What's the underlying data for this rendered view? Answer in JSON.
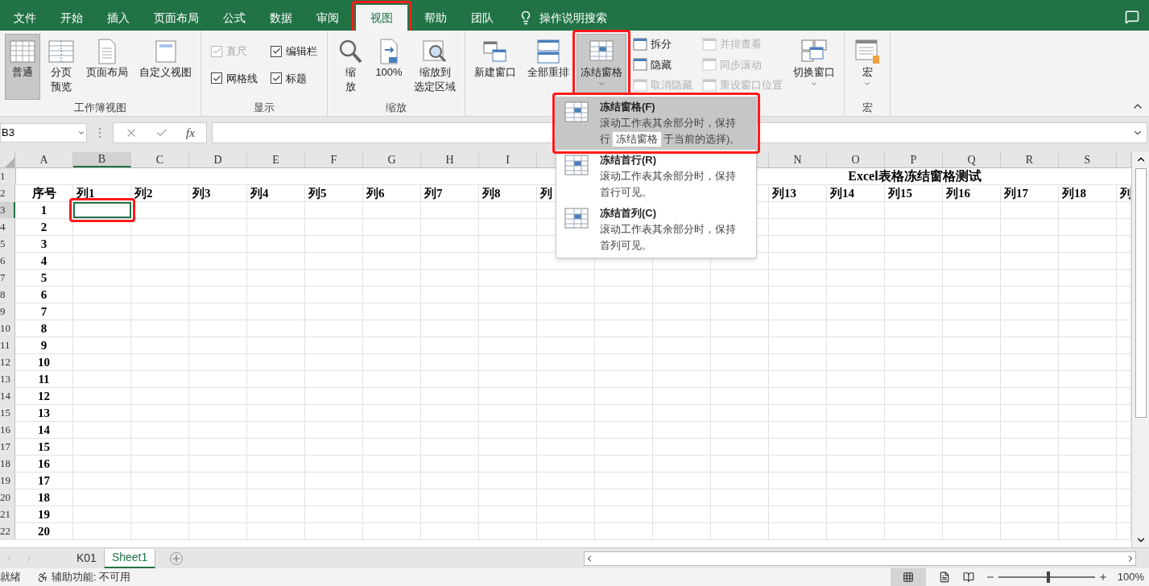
{
  "tabs": [
    {
      "label": "文件",
      "selected": false,
      "highlighted": false
    },
    {
      "label": "开始",
      "selected": false,
      "highlighted": false
    },
    {
      "label": "插入",
      "selected": false,
      "highlighted": false
    },
    {
      "label": "页面布局",
      "selected": false,
      "highlighted": false
    },
    {
      "label": "公式",
      "selected": false,
      "highlighted": false
    },
    {
      "label": "数据",
      "selected": false,
      "highlighted": false
    },
    {
      "label": "审阅",
      "selected": false,
      "highlighted": false
    },
    {
      "label": "视图",
      "selected": true,
      "highlighted": true
    },
    {
      "label": "帮助",
      "selected": false,
      "highlighted": false
    },
    {
      "label": "团队",
      "selected": false,
      "highlighted": false
    }
  ],
  "tell_me": "操作说明搜索",
  "ribbon": [
    {
      "label": "工作簿视图",
      "items": [
        {
          "kind": "large",
          "lines": [
            "普通"
          ],
          "selected": true
        },
        {
          "kind": "large",
          "lines": [
            "分页",
            "预览"
          ],
          "selected": false
        },
        {
          "kind": "large",
          "lines": [
            "页面布局"
          ],
          "selected": false
        },
        {
          "kind": "large",
          "lines": [
            "自定义视图"
          ],
          "selected": false
        }
      ]
    },
    {
      "label": "显示",
      "items": [
        {
          "kind": "check",
          "label": "直尺",
          "checked": true,
          "disabled": true
        },
        {
          "kind": "check",
          "label": "网格线",
          "checked": true,
          "disabled": false
        },
        {
          "kind": "check",
          "label": "编辑栏",
          "checked": true,
          "disabled": false
        },
        {
          "kind": "check",
          "label": "标题",
          "checked": true,
          "disabled": false
        }
      ]
    },
    {
      "label": "缩放",
      "items": [
        {
          "kind": "large",
          "lines": [
            "缩",
            "放"
          ],
          "selected": false
        },
        {
          "kind": "large",
          "lines": [
            "100%"
          ],
          "selected": false
        },
        {
          "kind": "large",
          "lines": [
            "缩放到",
            "选定区域"
          ],
          "selected": false
        }
      ]
    },
    {
      "items": [
        {
          "kind": "large",
          "lines": [
            "新建窗口"
          ],
          "selected": false
        },
        {
          "kind": "large",
          "lines": [
            "全部重排"
          ],
          "selected": false
        },
        {
          "kind": "large",
          "lines": [
            "冻结窗格"
          ],
          "selected": true,
          "caret": true,
          "highlighted": true
        },
        {
          "kind": "small",
          "label": "拆分",
          "disabled": false
        },
        {
          "kind": "small",
          "label": "隐藏",
          "disabled": false
        },
        {
          "kind": "small",
          "label": "取消隐藏",
          "disabled": true
        },
        {
          "kind": "small",
          "label": "并排查看",
          "disabled": true
        },
        {
          "kind": "small",
          "label": "同步滚动",
          "disabled": true
        },
        {
          "kind": "small",
          "label": "重设窗口位置",
          "disabled": true
        },
        {
          "kind": "large",
          "lines": [
            "切换窗口"
          ],
          "selected": false,
          "caret": true
        }
      ]
    },
    {
      "label": "宏",
      "items": [
        {
          "kind": "large",
          "lines": [
            "宏"
          ],
          "selected": false,
          "caret": true
        }
      ]
    }
  ],
  "formula_bar": {
    "name_box": "B3",
    "fx": "fx"
  },
  "columns": [
    {
      "letter": "A",
      "selected": false
    },
    {
      "letter": "B",
      "selected": true
    },
    {
      "letter": "C",
      "selected": false
    },
    {
      "letter": "D",
      "selected": false
    },
    {
      "letter": "E",
      "selected": false
    },
    {
      "letter": "F",
      "selected": false
    },
    {
      "letter": "G",
      "selected": false
    },
    {
      "letter": "H",
      "selected": false
    },
    {
      "letter": "I",
      "selected": false
    },
    null,
    null,
    null,
    null,
    {
      "letter": "N",
      "selected": false
    },
    {
      "letter": "O",
      "selected": false
    },
    {
      "letter": "P",
      "selected": false
    },
    {
      "letter": "Q",
      "selected": false
    },
    {
      "letter": "R",
      "selected": false
    },
    {
      "letter": "S",
      "selected": false
    },
    null
  ],
  "title_row": {
    "num": "1",
    "title": "Excel表格冻结窗格测试"
  },
  "header_row": {
    "num": "2",
    "cells": [
      "序号",
      "列1",
      "列2",
      "列3",
      "列4",
      "列5",
      "列6",
      "列7",
      "列8",
      "列",
      null,
      null,
      null,
      "列13",
      "列14",
      "列15",
      "列16",
      "列17",
      "列18",
      "列"
    ]
  },
  "rows": [
    {
      "num": "3",
      "value": "1",
      "selected": true,
      "highlighted": true
    },
    {
      "num": "4",
      "value": "2",
      "selected": false,
      "highlighted": false
    },
    {
      "num": "5",
      "value": "3",
      "selected": false,
      "highlighted": false
    },
    {
      "num": "6",
      "value": "4",
      "selected": false,
      "highlighted": false
    },
    {
      "num": "7",
      "value": "5",
      "selected": false,
      "highlighted": false
    },
    {
      "num": "8",
      "value": "6",
      "selected": false,
      "highlighted": false
    },
    {
      "num": "9",
      "value": "7",
      "selected": false,
      "highlighted": false
    },
    {
      "num": "10",
      "value": "8",
      "selected": false,
      "highlighted": false
    },
    {
      "num": "11",
      "value": "9",
      "selected": false,
      "highlighted": false
    },
    {
      "num": "12",
      "value": "10",
      "selected": false,
      "highlighted": false
    },
    {
      "num": "13",
      "value": "11",
      "selected": false,
      "highlighted": false
    },
    {
      "num": "14",
      "value": "12",
      "selected": false,
      "highlighted": false
    },
    {
      "num": "15",
      "value": "13",
      "selected": false,
      "highlighted": false
    },
    {
      "num": "16",
      "value": "14",
      "selected": false,
      "highlighted": false
    },
    {
      "num": "17",
      "value": "15",
      "selected": false,
      "highlighted": false
    },
    {
      "num": "18",
      "value": "16",
      "selected": false,
      "highlighted": false
    },
    {
      "num": "19",
      "value": "17",
      "selected": false,
      "highlighted": false
    },
    {
      "num": "20",
      "value": "18",
      "selected": false,
      "highlighted": false
    },
    {
      "num": "21",
      "value": "19",
      "selected": false,
      "highlighted": false
    },
    {
      "num": "22",
      "value": "20",
      "selected": false,
      "highlighted": false
    }
  ],
  "freeze_menu": {
    "tooltip": "冻结窗格",
    "items": [
      {
        "title": "冻结窗格(F)",
        "line1": "滚动工作表其余部分时，保持",
        "line2_before": "行",
        "line2_after": "于当前的选择)。",
        "selected": true,
        "highlighted": true
      },
      {
        "title": "冻结首行(R)",
        "line1": "滚动工作表其余部分时，保持",
        "line2_before": "首行可见。",
        "selected": false,
        "highlighted": false
      },
      {
        "title": "冻结首列(C)",
        "line1": "滚动工作表其余部分时，保持",
        "line2_before": "首列可见。",
        "selected": false,
        "highlighted": false
      }
    ]
  },
  "sheets": [
    {
      "label": "K01",
      "selected": false
    },
    {
      "label": "Sheet1",
      "selected": true
    }
  ],
  "status": {
    "ready": "就绪",
    "accessibility": "辅助功能: 不可用",
    "zoom": {
      "level": 0.52,
      "reading": "100%"
    }
  }
}
